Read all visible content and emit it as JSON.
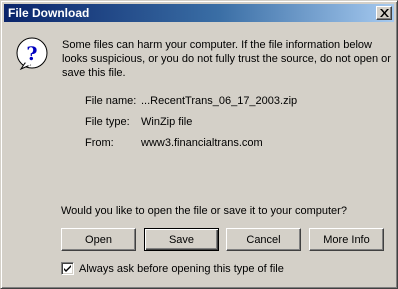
{
  "window": {
    "title": "File Download",
    "close_icon": "close-x-icon"
  },
  "dialog": {
    "icon": "question-mark-icon",
    "warning_text": "Some files can harm your computer. If the file information below looks suspicious, or you do not fully trust the source, do not open or save this file.",
    "fields": [
      {
        "label": "File name:",
        "value": "...RecentTrans_06_17_2003.zip"
      },
      {
        "label": "File type:",
        "value": "WinZip file"
      },
      {
        "label": "From:",
        "value": "www3.financialtrans.com"
      }
    ],
    "question": "Would you like to open the file or save it to your computer?"
  },
  "buttons": {
    "open": "Open",
    "save": "Save",
    "cancel": "Cancel",
    "more_info": "More Info"
  },
  "checkbox": {
    "checked": true,
    "label": "Always ask before opening this type of file"
  }
}
